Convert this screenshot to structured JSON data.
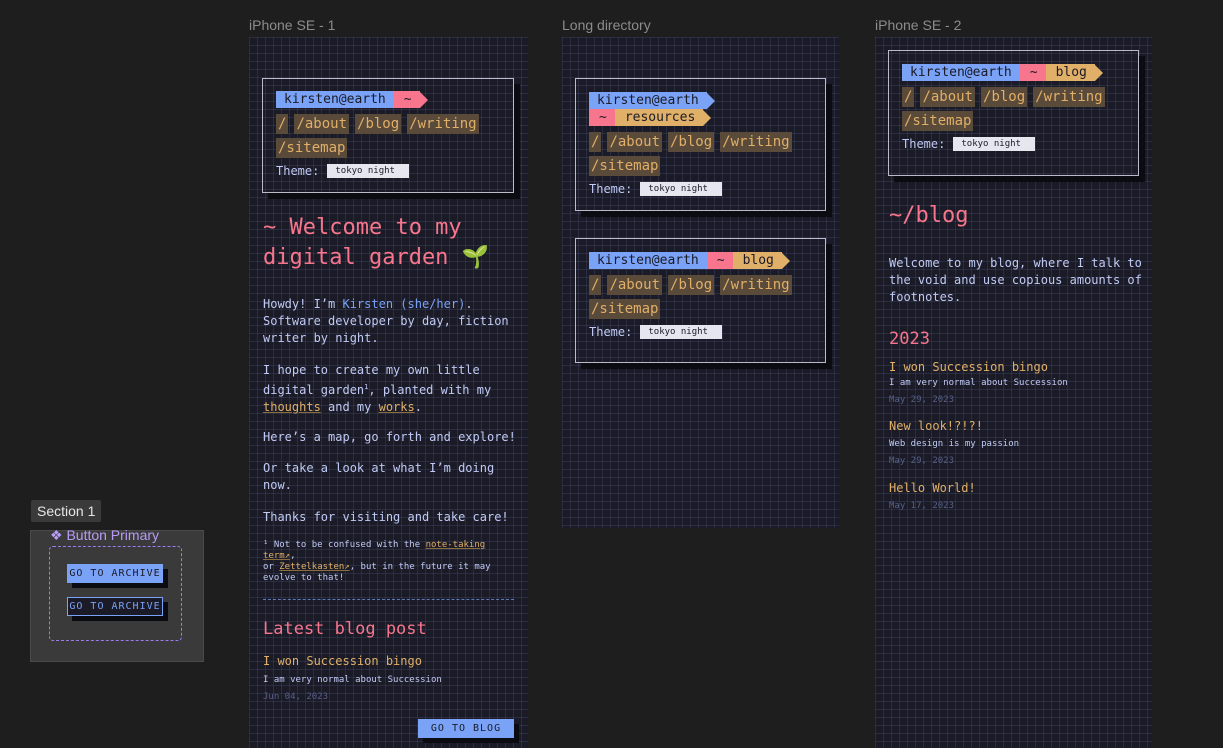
{
  "frames": {
    "iphone_se_1": "iPhone SE - 1",
    "long_directory": "Long directory",
    "iphone_se_2": "iPhone SE - 2"
  },
  "nav": {
    "user": "kirsten@earth",
    "tilde": "~",
    "links": [
      "/",
      "/about",
      "/blog",
      "/writing",
      "/sitemap"
    ],
    "theme_label": "Theme:",
    "theme_value": "tokyo night"
  },
  "prompt_paths": {
    "resources": "resources",
    "blog": "blog"
  },
  "home": {
    "title_line1": "~ Welcome to my",
    "title_line2": "digital garden",
    "sprout": "🌱",
    "p1_pre": "Howdy! I’m ",
    "p1_name": "Kirsten (she/her)",
    "p1_post": ".",
    "p1_line2": "Software developer by day, fiction",
    "p1_line3": "writer by night.",
    "p2_line1": "I hope to create my own little",
    "p2_line2_a": "digital garden",
    "p2_sup": "1",
    "p2_line2_b": ", planted with my",
    "p2_thoughts": "thoughts",
    "p2_and": " and my ",
    "p2_works": "works",
    "p2_end": ".",
    "p3": "Here’s a map, go forth and explore!",
    "p4_line1": "Or take a look at what I’m doing",
    "p4_line2": "now.",
    "p5": "Thanks for visiting and take care!",
    "fn_line1_pre": "¹ Not to be confused with the ",
    "fn_link1": "note-taking term↗",
    "fn_line1_post": ",",
    "fn_line2_pre": "or ",
    "fn_link2": "Zettelkasten↗",
    "fn_line2_post": ", but in the future it may",
    "fn_line3": "evolve to that!",
    "latest_heading": "Latest blog post",
    "post_title": "I won Succession bingo",
    "post_desc": "I am very normal about Succession",
    "post_date": "Jun 04, 2023",
    "go_to_blog": "GO TO BLOG"
  },
  "blog": {
    "title": "~/blog",
    "intro_line1": "Welcome to my blog, where I talk to",
    "intro_line2": "the void and use copious amounts of",
    "intro_line3": "footnotes.",
    "year": "2023",
    "posts": [
      {
        "title": "I won Succession bingo",
        "desc": "I am very normal about Succession",
        "date": "May 29, 2023"
      },
      {
        "title": "New look!?!?!",
        "desc": "Web design is my passion",
        "date": "May 29, 2023"
      },
      {
        "title": "Hello World!",
        "desc": "",
        "date": "May 17, 2023"
      }
    ]
  },
  "section": {
    "label": "Section 1",
    "component_label": "❖ Button Primary",
    "button1": "GO TO ARCHIVE",
    "button2": "GO TO ARCHIVE"
  },
  "colors": {
    "background": "#1a1b26",
    "blue": "#7aa2f7",
    "pink": "#f7768e",
    "yellow": "#e0af68",
    "text": "#c0caf5",
    "component_purple": "#9d7bf0"
  }
}
